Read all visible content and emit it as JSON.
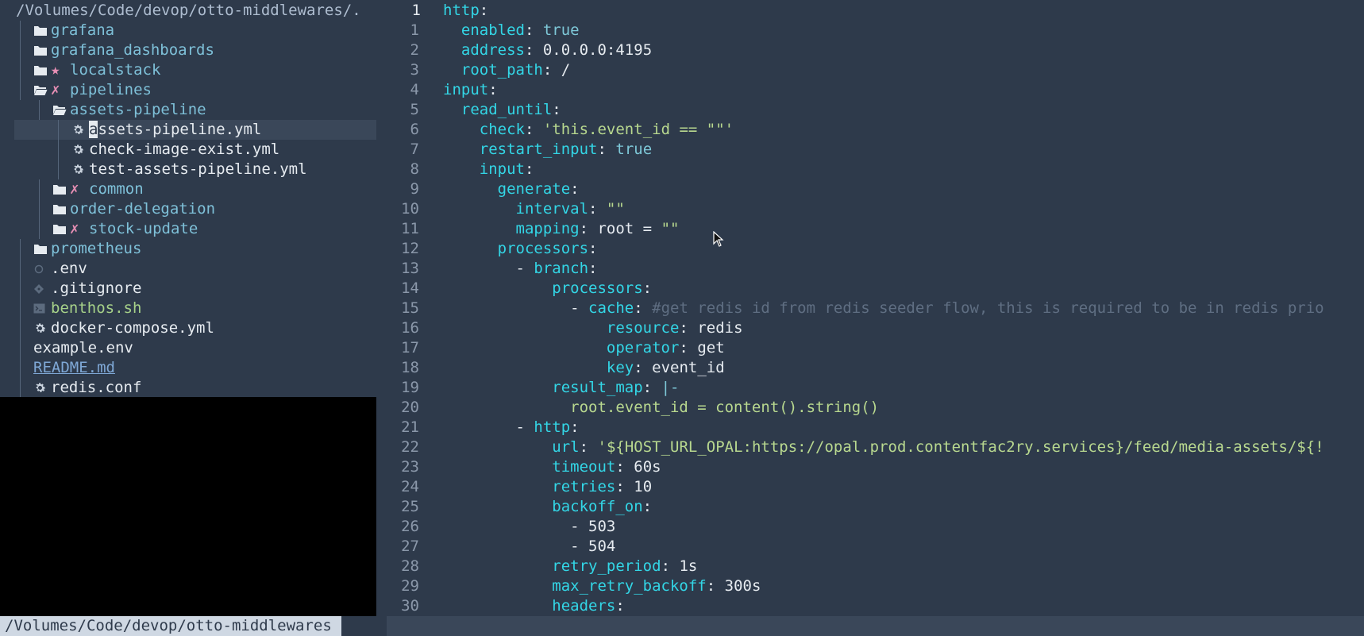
{
  "tree": {
    "root_path": "/Volumes/Code/devop/otto-middlewares/.",
    "items": [
      {
        "name": "grafana",
        "kind": "dir",
        "depth": 1,
        "mark": ""
      },
      {
        "name": "grafana_dashboards",
        "kind": "dir",
        "depth": 1,
        "mark": ""
      },
      {
        "name": "localstack",
        "kind": "dir",
        "depth": 1,
        "mark": "★"
      },
      {
        "name": "pipelines",
        "kind": "dir-open",
        "depth": 1,
        "mark": "✗"
      },
      {
        "name": "assets-pipeline",
        "kind": "dir-open",
        "depth": 2,
        "mark": ""
      },
      {
        "name": "assets-pipeline.yml",
        "kind": "gear",
        "depth": 3,
        "mark": "",
        "selected": true
      },
      {
        "name": "check-image-exist.yml",
        "kind": "gear",
        "depth": 3,
        "mark": ""
      },
      {
        "name": "test-assets-pipeline.yml",
        "kind": "gear",
        "depth": 3,
        "mark": ""
      },
      {
        "name": "common",
        "kind": "dir",
        "depth": 2,
        "mark": "✗"
      },
      {
        "name": "order-delegation",
        "kind": "dir",
        "depth": 2,
        "mark": ""
      },
      {
        "name": "stock-update",
        "kind": "dir",
        "depth": 2,
        "mark": "✗"
      },
      {
        "name": "prometheus",
        "kind": "dir",
        "depth": 1,
        "mark": ""
      },
      {
        "name": ".env",
        "kind": "circle",
        "depth": 1,
        "mark": ""
      },
      {
        "name": ".gitignore",
        "kind": "diamond",
        "depth": 1,
        "mark": ""
      },
      {
        "name": "benthos.sh",
        "kind": "script",
        "depth": 1,
        "mark": ""
      },
      {
        "name": "docker-compose.yml",
        "kind": "gear",
        "depth": 1,
        "mark": ""
      },
      {
        "name": "example.env",
        "kind": "none",
        "depth": 1,
        "mark": ""
      },
      {
        "name": "README.md",
        "kind": "link",
        "depth": 1,
        "mark": ""
      },
      {
        "name": "redis.conf",
        "kind": "gear",
        "depth": 1,
        "mark": ""
      }
    ]
  },
  "editor": {
    "current_line_number": "1",
    "lines": [
      [
        [
          "k",
          "http"
        ],
        [
          "p",
          ":"
        ]
      ],
      [
        [
          "p",
          "  "
        ],
        [
          "k",
          "enabled"
        ],
        [
          "p",
          ": "
        ],
        [
          "bool",
          "true"
        ]
      ],
      [
        [
          "p",
          "  "
        ],
        [
          "k",
          "address"
        ],
        [
          "p",
          ": "
        ],
        [
          "v",
          "0.0.0.0:4195"
        ]
      ],
      [
        [
          "p",
          "  "
        ],
        [
          "k",
          "root_path"
        ],
        [
          "p",
          ": "
        ],
        [
          "v",
          "/"
        ]
      ],
      [
        [
          "k",
          "input"
        ],
        [
          "p",
          ":"
        ]
      ],
      [
        [
          "p",
          "  "
        ],
        [
          "k",
          "read_until"
        ],
        [
          "p",
          ":"
        ]
      ],
      [
        [
          "p",
          "    "
        ],
        [
          "k",
          "check"
        ],
        [
          "p",
          ": "
        ],
        [
          "str",
          "'this.event_id == \"\"'"
        ]
      ],
      [
        [
          "p",
          "    "
        ],
        [
          "k",
          "restart_input"
        ],
        [
          "p",
          ": "
        ],
        [
          "bool",
          "true"
        ]
      ],
      [
        [
          "p",
          "    "
        ],
        [
          "k",
          "input"
        ],
        [
          "p",
          ":"
        ]
      ],
      [
        [
          "p",
          "      "
        ],
        [
          "k",
          "generate"
        ],
        [
          "p",
          ":"
        ]
      ],
      [
        [
          "p",
          "        "
        ],
        [
          "k",
          "interval"
        ],
        [
          "p",
          ": "
        ],
        [
          "str",
          "\"\""
        ]
      ],
      [
        [
          "p",
          "        "
        ],
        [
          "k",
          "mapping"
        ],
        [
          "p",
          ": "
        ],
        [
          "v",
          "root = "
        ],
        [
          "str",
          "\"\""
        ]
      ],
      [
        [
          "p",
          "      "
        ],
        [
          "k",
          "processors"
        ],
        [
          "p",
          ":"
        ]
      ],
      [
        [
          "p",
          "        "
        ],
        [
          "dash",
          "- "
        ],
        [
          "k",
          "branch"
        ],
        [
          "p",
          ":"
        ]
      ],
      [
        [
          "p",
          "            "
        ],
        [
          "k",
          "processors"
        ],
        [
          "p",
          ":"
        ]
      ],
      [
        [
          "p",
          "              "
        ],
        [
          "dash",
          "- "
        ],
        [
          "k",
          "cache"
        ],
        [
          "p",
          ": "
        ],
        [
          "cmt",
          "#get redis id from redis seeder flow, this is required to be in redis prio"
        ]
      ],
      [
        [
          "p",
          "                  "
        ],
        [
          "k",
          "resource"
        ],
        [
          "p",
          ": "
        ],
        [
          "v",
          "redis"
        ]
      ],
      [
        [
          "p",
          "                  "
        ],
        [
          "k",
          "operator"
        ],
        [
          "p",
          ": "
        ],
        [
          "v",
          "get"
        ]
      ],
      [
        [
          "p",
          "                  "
        ],
        [
          "k",
          "key"
        ],
        [
          "p",
          ": "
        ],
        [
          "v",
          "event_id"
        ]
      ],
      [
        [
          "p",
          "            "
        ],
        [
          "k",
          "result_map"
        ],
        [
          "p",
          ": "
        ],
        [
          "blk",
          "|-"
        ]
      ],
      [
        [
          "p",
          "              "
        ],
        [
          "str",
          "root.event_id = content().string()"
        ]
      ],
      [
        [
          "p",
          "        "
        ],
        [
          "dash",
          "- "
        ],
        [
          "k",
          "http"
        ],
        [
          "p",
          ":"
        ]
      ],
      [
        [
          "p",
          "            "
        ],
        [
          "k",
          "url"
        ],
        [
          "p",
          ": "
        ],
        [
          "str",
          "'${HOST_URL_OPAL:https://opal.prod.contentfac2ry.services}/feed/media-assets/${!"
        ]
      ],
      [
        [
          "p",
          "            "
        ],
        [
          "k",
          "timeout"
        ],
        [
          "p",
          ": "
        ],
        [
          "v",
          "60s"
        ]
      ],
      [
        [
          "p",
          "            "
        ],
        [
          "k",
          "retries"
        ],
        [
          "p",
          ": "
        ],
        [
          "v",
          "10"
        ]
      ],
      [
        [
          "p",
          "            "
        ],
        [
          "k",
          "backoff_on"
        ],
        [
          "p",
          ":"
        ]
      ],
      [
        [
          "p",
          "              "
        ],
        [
          "dash",
          "- "
        ],
        [
          "v",
          "503"
        ]
      ],
      [
        [
          "p",
          "              "
        ],
        [
          "dash",
          "- "
        ],
        [
          "v",
          "504"
        ]
      ],
      [
        [
          "p",
          "            "
        ],
        [
          "k",
          "retry_period"
        ],
        [
          "p",
          ": "
        ],
        [
          "v",
          "1s"
        ]
      ],
      [
        [
          "p",
          "            "
        ],
        [
          "k",
          "max_retry_backoff"
        ],
        [
          "p",
          ": "
        ],
        [
          "v",
          "300s"
        ]
      ],
      [
        [
          "p",
          "            "
        ],
        [
          "k",
          "headers"
        ],
        [
          "p",
          ":"
        ]
      ]
    ],
    "line_numbers": [
      "1",
      "1",
      "2",
      "3",
      "4",
      "5",
      "6",
      "7",
      "8",
      "9",
      "10",
      "11",
      "12",
      "13",
      "14",
      "15",
      "16",
      "17",
      "18",
      "19",
      "20",
      "21",
      "22",
      "23",
      "24",
      "25",
      "26",
      "27",
      "28",
      "29",
      "30"
    ]
  },
  "status": {
    "path": "/Volumes/Code/devop/otto-middlewares"
  },
  "colors": {
    "background": "#2e3a4b",
    "key": "#33d6e6",
    "string": "#b8d88f",
    "comment": "#5f6e82",
    "directory": "#7ec0d8",
    "git_mark": "#e88fb5"
  }
}
